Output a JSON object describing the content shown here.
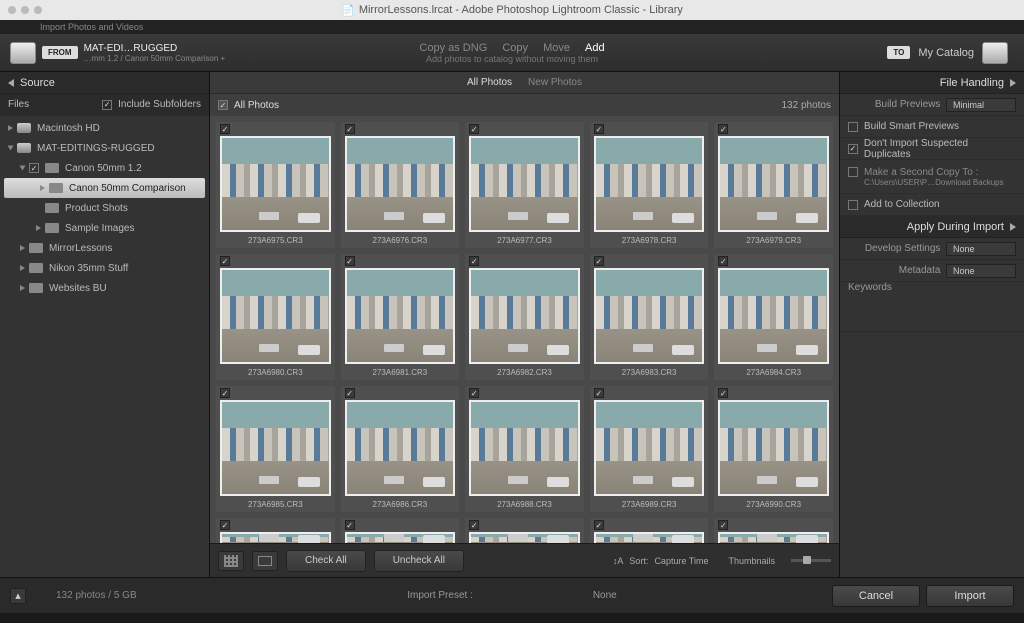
{
  "title": "MirrorLessons.lrcat - Adobe Photoshop Lightroom Classic - Library",
  "tabline": "Import Photos and Videos",
  "from_badge": "FROM",
  "to_badge": "TO",
  "source_title": "MAT-EDI…RUGGED",
  "source_sub": "…mm 1.2 / Canon 50mm Comparison +",
  "actions": {
    "copy_dng": "Copy as DNG",
    "copy": "Copy",
    "move": "Move",
    "add": "Add",
    "sub": "Add photos to catalog without moving them"
  },
  "to_label": "My Catalog",
  "left": {
    "header": "Source",
    "files": "Files",
    "include": "Include Subfolders",
    "tree": [
      {
        "label": "Macintosh HD",
        "icon": "drv",
        "indent": 0,
        "arrow": "closed"
      },
      {
        "label": "MAT-EDITINGS-RUGGED",
        "icon": "drv",
        "indent": 0,
        "arrow": "open",
        "dark": true
      },
      {
        "label": "Canon 50mm 1.2",
        "icon": "fold",
        "indent": 1,
        "arrow": "open",
        "chk": true
      },
      {
        "label": "Canon 50mm Comparison",
        "icon": "fold",
        "indent": 2,
        "arrow": "closed",
        "sel": true
      },
      {
        "label": "Product Shots",
        "icon": "fold",
        "indent": 2,
        "arrow": "none"
      },
      {
        "label": "Sample Images",
        "icon": "fold",
        "indent": 2,
        "arrow": "closed"
      },
      {
        "label": "MirrorLessons",
        "icon": "fold",
        "indent": 1,
        "arrow": "closed"
      },
      {
        "label": "Nikon 35mm Stuff",
        "icon": "fold",
        "indent": 1,
        "arrow": "closed"
      },
      {
        "label": "Websites BU",
        "icon": "fold",
        "indent": 1,
        "arrow": "closed"
      }
    ]
  },
  "tabs": {
    "all": "All Photos",
    "new": "New Photos"
  },
  "gridhead": {
    "title": "All Photos",
    "count": "132 photos"
  },
  "files_list": [
    "273A6975.CR3",
    "273A6976.CR3",
    "273A6977.CR3",
    "273A6978.CR3",
    "273A6979.CR3",
    "273A6980.CR3",
    "273A6981.CR3",
    "273A6982.CR3",
    "273A6983.CR3",
    "273A6984.CR3",
    "273A6985.CR3",
    "273A6986.CR3",
    "273A6988.CR3",
    "273A6989.CR3",
    "273A6990.CR3"
  ],
  "toolbar": {
    "check_all": "Check All",
    "uncheck_all": "Uncheck All",
    "sort_label": "Sort:",
    "sort_value": "Capture Time",
    "thumbs": "Thumbnails"
  },
  "right": {
    "file_handling": "File Handling",
    "build_previews_label": "Build Previews",
    "build_previews_value": "Minimal",
    "smart": "Build Smart Previews",
    "dup": "Don't Import Suspected Duplicates",
    "second": "Make a Second Copy To :",
    "second_path": "C:\\Users\\USER\\P…Download Backups",
    "collection": "Add to Collection",
    "apply": "Apply During Import",
    "dev_label": "Develop Settings",
    "dev_value": "None",
    "meta_label": "Metadata",
    "meta_value": "None",
    "keywords": "Keywords"
  },
  "footer": {
    "info": "132 photos / 5 GB",
    "preset_label": "Import Preset :",
    "preset_value": "None",
    "cancel": "Cancel",
    "import": "Import"
  }
}
